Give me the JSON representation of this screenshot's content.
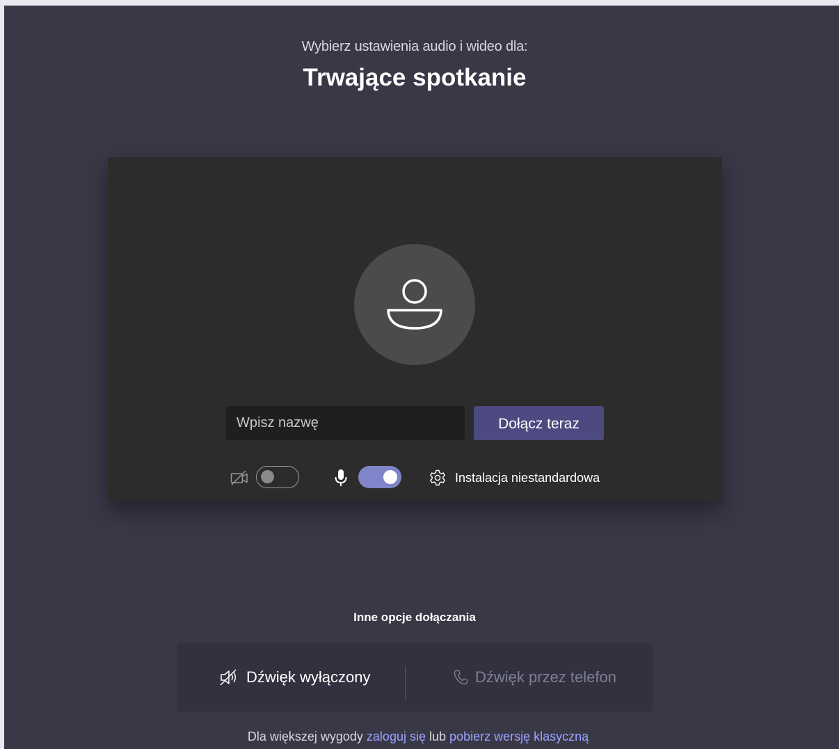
{
  "header": {
    "subtitle": "Wybierz ustawienia audio i wideo dla:",
    "title": "Trwające spotkanie"
  },
  "preview": {
    "avatar_icon": "person-icon",
    "name_input": {
      "value": "",
      "placeholder": "Wpisz nazwę"
    },
    "join_button": "Dołącz teraz",
    "controls": {
      "camera": {
        "icon": "camera-off-icon",
        "enabled": false
      },
      "microphone": {
        "icon": "microphone-icon",
        "enabled": true
      },
      "settings": {
        "icon": "gear-icon",
        "label": "Instalacja niestandardowa"
      }
    }
  },
  "other_options": {
    "heading": "Inne opcje dołączania",
    "audio_off": {
      "icon": "speaker-off-icon",
      "label": "Dźwięk wyłączony"
    },
    "phone_audio": {
      "icon": "phone-icon",
      "label": "Dźwięk przez telefon",
      "disabled": true
    }
  },
  "footer": {
    "prefix": "Dla większej wygody",
    "sign_in_link": "zaloguj się",
    "middle": "lub",
    "download_link": "pobierz wersję klasyczną"
  },
  "colors": {
    "page_background": "#383847",
    "preview_background": "#2d2c2c",
    "accent": "#4c4a80",
    "toggle_on": "#7f85c8",
    "link": "#9ea2ff"
  }
}
